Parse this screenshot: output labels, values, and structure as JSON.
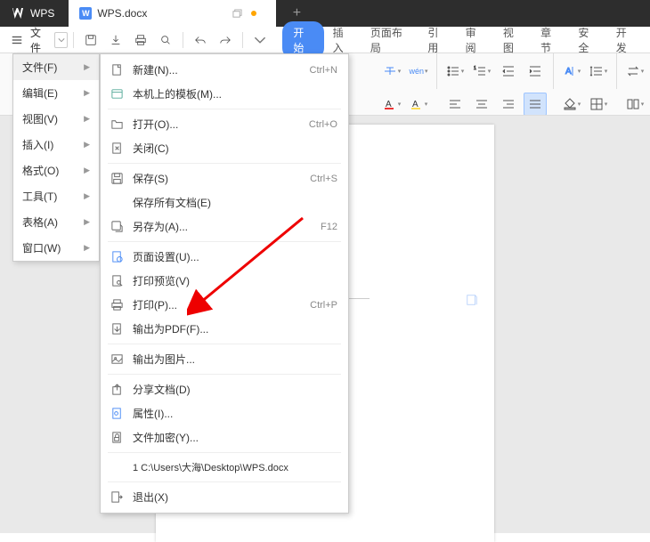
{
  "titlebar": {
    "app_name": "WPS",
    "doc_name": "WPS.docx",
    "doc_icon_letter": "W"
  },
  "toolbar": {
    "file_label": "文件"
  },
  "ribbon_tabs": {
    "start": "开始",
    "insert": "插入",
    "page_layout": "页面布局",
    "reference": "引用",
    "review": "审阅",
    "view": "视图",
    "chapter": "章节",
    "safety": "安全",
    "dev": "开发"
  },
  "left_menu": {
    "file": "文件(F)",
    "edit": "编辑(E)",
    "view": "视图(V)",
    "insert": "插入(I)",
    "format": "格式(O)",
    "tools": "工具(T)",
    "table": "表格(A)",
    "window": "窗口(W)"
  },
  "file_menu": {
    "new": "新建(N)...",
    "new_sc": "Ctrl+N",
    "template": "本机上的模板(M)...",
    "open": "打开(O)...",
    "open_sc": "Ctrl+O",
    "close": "关闭(C)",
    "save": "保存(S)",
    "save_sc": "Ctrl+S",
    "save_all": "保存所有文档(E)",
    "save_as": "另存为(A)...",
    "save_as_sc": "F12",
    "page_setup": "页面设置(U)...",
    "print_preview": "打印预览(V)",
    "print": "打印(P)...",
    "print_sc": "Ctrl+P",
    "export_pdf": "输出为PDF(F)...",
    "export_image": "输出为图片...",
    "share": "分享文档(D)",
    "properties": "属性(I)...",
    "encrypt": "文件加密(Y)...",
    "recent1": "1 C:\\Users\\大海\\Desktop\\WPS.docx",
    "exit": "退出(X)"
  }
}
